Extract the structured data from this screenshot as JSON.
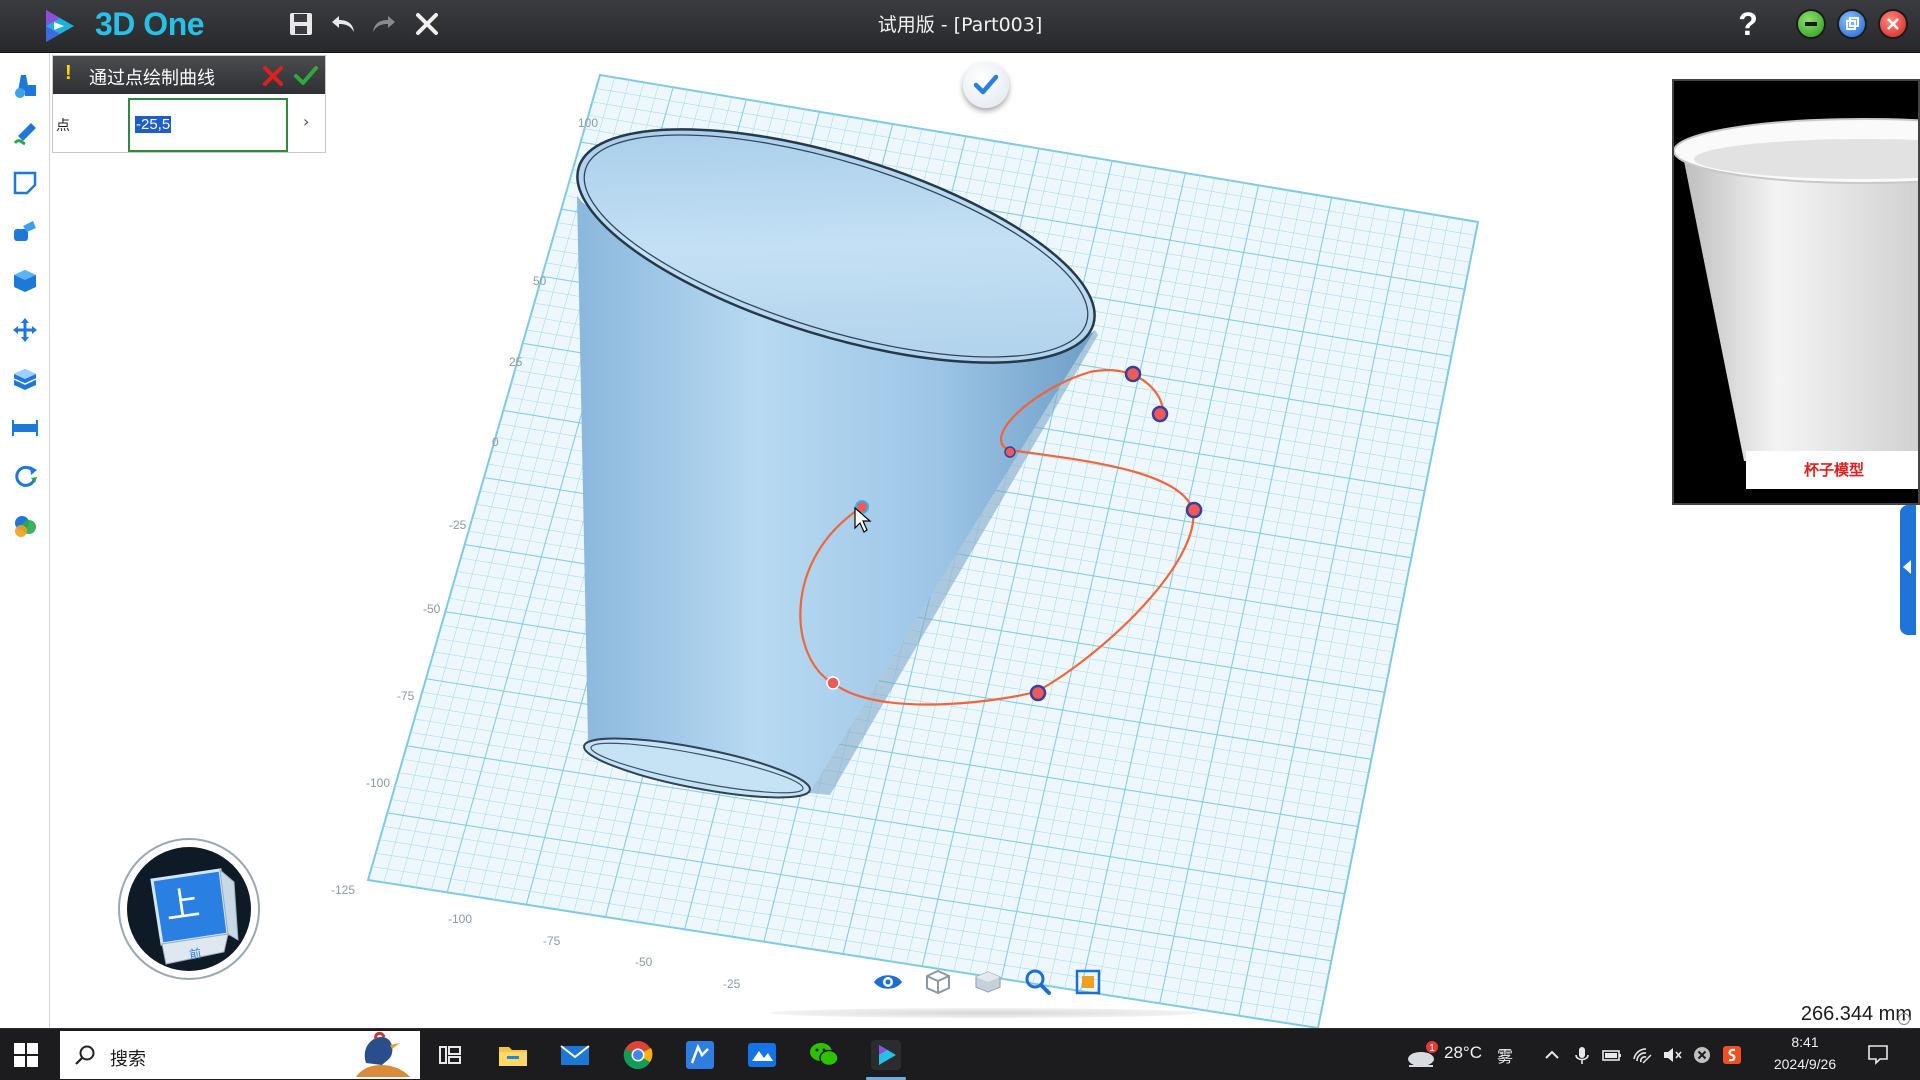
{
  "titlebar": {
    "app_name": "3D One",
    "window_title": "试用版 - [Part003]",
    "help_label": "?"
  },
  "command_panel": {
    "warning_glyph": "!",
    "title": "通过点绘制曲线",
    "field_label": "点",
    "field_value": "-25,5",
    "expand_glyph": "›"
  },
  "viewport": {
    "grid_labels": [
      "100",
      "50",
      "25",
      "0",
      "-25",
      "-50",
      "-75",
      "-100",
      "-125",
      "-100",
      "-75",
      "-50",
      "-25"
    ],
    "preview_label": "杯子模型",
    "view_cube_top_label": "上",
    "view_cube_front_label": "前",
    "measure_value": "266.344 mm",
    "measure_caret": "⌄"
  },
  "bottom_tools": [
    "eye-icon",
    "wireframe-cube-icon",
    "transparent-cube-icon",
    "zoom-icon",
    "fit-view-icon"
  ],
  "taskbar": {
    "search_placeholder": "搜索",
    "apps": [
      "task-view",
      "file-explorer",
      "mail",
      "chrome",
      "app-blue",
      "app-photos",
      "wechat",
      "3d-one"
    ],
    "weather_badge": "1",
    "temperature": "28°C",
    "weather_condition": "雾",
    "time": "8:41",
    "date": "2024/9/26"
  },
  "colors": {
    "accent": "#27c0e6",
    "grid": "#8fd4ec",
    "curve": "#f0653b",
    "model": "#9cc8e8",
    "confirm": "#2eaa3c",
    "cancel": "#e02020"
  }
}
